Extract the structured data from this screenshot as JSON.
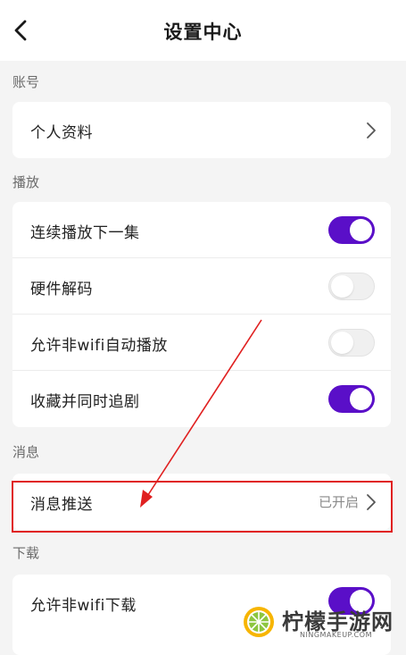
{
  "header": {
    "title": "设置中心",
    "back_icon": "chevron-left-icon"
  },
  "sections": {
    "account": {
      "label": "账号",
      "rows": [
        {
          "label": "个人资料",
          "control": "chevron-right-icon"
        }
      ]
    },
    "playback": {
      "label": "播放",
      "rows": [
        {
          "label": "连续播放下一集",
          "toggle": "on"
        },
        {
          "label": "硬件解码",
          "toggle": "off"
        },
        {
          "label": "允许非wifi自动播放",
          "toggle": "off"
        },
        {
          "label": "收藏并同时追剧",
          "toggle": "on"
        }
      ]
    },
    "message": {
      "label": "消息",
      "rows": [
        {
          "label": "消息推送",
          "value": "已开启",
          "control": "chevron-right-icon"
        }
      ]
    },
    "download": {
      "label": "下载",
      "rows": [
        {
          "label": "允许非wifi下载",
          "toggle": "on"
        }
      ]
    }
  },
  "annotation": {
    "highlight_color": "#e02020",
    "arrow_color": "#e02020"
  },
  "colors": {
    "toggle_on": "#5a0fc8",
    "toggle_off": "#f0f0f0",
    "background": "#f4f4f4"
  },
  "watermark": {
    "name": "柠檬手游网",
    "domain": "NINGMAKEUP.COM"
  }
}
